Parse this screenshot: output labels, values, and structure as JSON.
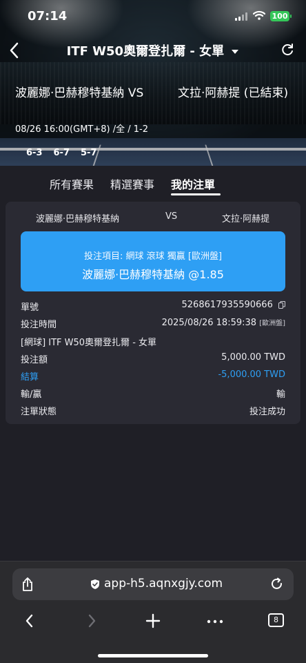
{
  "status_bar": {
    "time": "07:14",
    "battery": "100"
  },
  "header": {
    "title": "ITF W50奧爾登扎爾 - 女單"
  },
  "match": {
    "home_team": "波麗娜·巴赫穆特基納",
    "vs": "VS",
    "away_team": "文拉·阿赫提 (已結束)",
    "time_info": "08/26 16:00(GMT+8)  /全 / 1-2",
    "set_scores": [
      "6-3",
      "6-7",
      "5-7"
    ]
  },
  "tabs": [
    {
      "label": "所有賽果"
    },
    {
      "label": "精選賽事"
    },
    {
      "label": "我的注單",
      "active": true
    }
  ],
  "bet": {
    "home": "波麗娜·巴赫穆特基納",
    "vs": "VS",
    "away": "文拉·阿赫提",
    "item_line": "投注項目: 網球  滾球  獨贏  [歐洲盤]",
    "selection": "波麗娜·巴赫穆特基納 @1.85",
    "rows": {
      "ticket_label": "單號",
      "ticket_value": "5268617935590666",
      "time_label": "投注時間",
      "time_value": "2025/08/26 18:59:38",
      "time_sub": "[歐洲盤]",
      "event_label": "[網球] ITF W50奧爾登扎爾 - 女單",
      "stake_label": "投注額",
      "stake_value": "5,000.00 TWD",
      "settle_label": "結算",
      "settle_value": "-5,000.00 TWD",
      "result_label": "輸/贏",
      "result_value": "輸",
      "status_label": "注單狀態",
      "status_value": "投注成功"
    }
  },
  "browser": {
    "url": "app-h5.aqnxgjy.com",
    "tab_count": "8"
  },
  "colors": {
    "accent": "#2e9ff4",
    "background": "#1f1f26",
    "card": "#2a2a33",
    "battery": "#34c759"
  }
}
